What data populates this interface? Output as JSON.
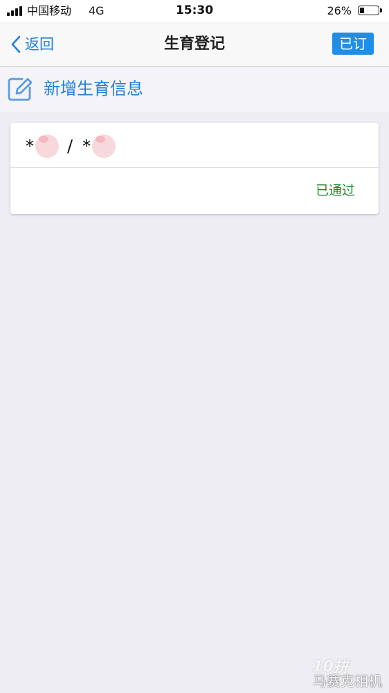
{
  "status_bar": {
    "carrier": "中国移动",
    "network": "4G",
    "time": "15:30",
    "battery_text": "26%",
    "battery_level": 0.26,
    "signal_icon": "signal-bars-icon",
    "battery_icon": "battery-icon"
  },
  "nav": {
    "back_label": "返回",
    "back_icon": "chevron-left-icon",
    "title": "生育登记",
    "subscribe_label": "已订"
  },
  "add_action": {
    "icon": "edit-icon",
    "label": "新增生育信息"
  },
  "records": [
    {
      "name_one": "*",
      "separator": "/",
      "name_two": "*",
      "status": "已通过"
    }
  ],
  "watermark": {
    "logo": "10拼",
    "text": "马赛克相机"
  },
  "colors": {
    "accent": "#1f7fd8",
    "button": "#1f8ee8",
    "status_passed": "#1f8a2a",
    "background": "#ededf3"
  }
}
